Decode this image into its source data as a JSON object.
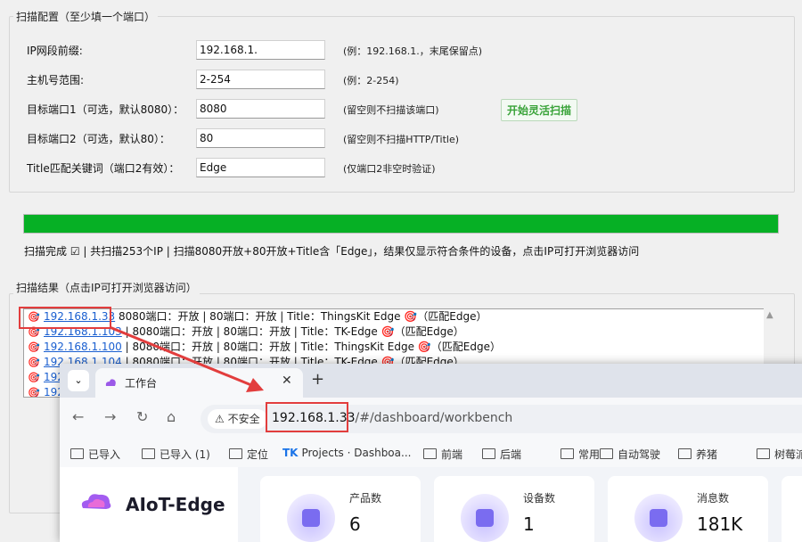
{
  "config": {
    "title": "扫描配置（至少填一个端口）",
    "rows": [
      {
        "label": "IP网段前缀:",
        "value": "192.168.1.",
        "hint": "(例：192.168.1.，末尾保留点)"
      },
      {
        "label": "主机号范围:",
        "value": "2-254",
        "hint": "(例：2-254)"
      },
      {
        "label": "目标端口1（可选，默认8080）：",
        "value": "8080",
        "hint": "(留空则不扫描该端口)"
      },
      {
        "label": "目标端口2（可选，默认80）：",
        "value": "80",
        "hint": "(留空则不扫描HTTP/Title)"
      },
      {
        "label": "Title匹配关键词（端口2有效）：",
        "value": "Edge",
        "hint": "(仅端口2非空时验证)"
      }
    ],
    "scan_button": "开始灵活扫描"
  },
  "progress": {
    "percent": 100,
    "color": "#06b025"
  },
  "status_text": "扫描完成 ☑ | 共扫描253个IP | 扫描8080开放+80开放+Title含「Edge」，结果仅显示符合条件的设备，点击IP可打开浏览器访问",
  "results": {
    "title": "扫描结果（点击IP可打开浏览器访问）",
    "rows": [
      {
        "icon": "🎯",
        "ip": "192.168.1.33",
        "text": " 8080端口：开放 | 80端口：开放 | Title：ThingsKit Edge 🎯（匹配Edge）"
      },
      {
        "icon": "🎯",
        "ip": "192.168.1.103",
        "text": " | 8080端口：开放 | 80端口：开放 | Title：TK-Edge 🎯（匹配Edge）"
      },
      {
        "icon": "🎯",
        "ip": "192.168.1.100",
        "text": " | 8080端口：开放 | 80端口：开放 | Title：ThingsKit Edge 🎯（匹配Edge）"
      },
      {
        "icon": "🎯",
        "ip": "192.168.1.104",
        "text": " | 8080端口：开放 | 80端口：开放 | Title：TK-Edge 🎯（匹配Edge）"
      },
      {
        "icon": "🎯",
        "ip": "192",
        "text": ""
      },
      {
        "icon": "🎯",
        "ip": "192",
        "text": ""
      }
    ]
  },
  "browser": {
    "tab_title": "工作台",
    "insecure_label": "不安全",
    "url_host": "192.168.1.33",
    "url_rest": "/#/dashboard/workbench",
    "bookmarks": [
      "已导入",
      "已导入 (1)",
      "定位",
      "Projects · Dashboa...",
      "前端",
      "后端",
      "常用",
      "自动驾驶",
      "养猪",
      "树莓派"
    ],
    "app_name": "AIoT-Edge",
    "cards": [
      {
        "label": "产品数",
        "value": "6"
      },
      {
        "label": "设备数",
        "value": "1"
      },
      {
        "label": "消息数",
        "value": "181K"
      }
    ]
  }
}
